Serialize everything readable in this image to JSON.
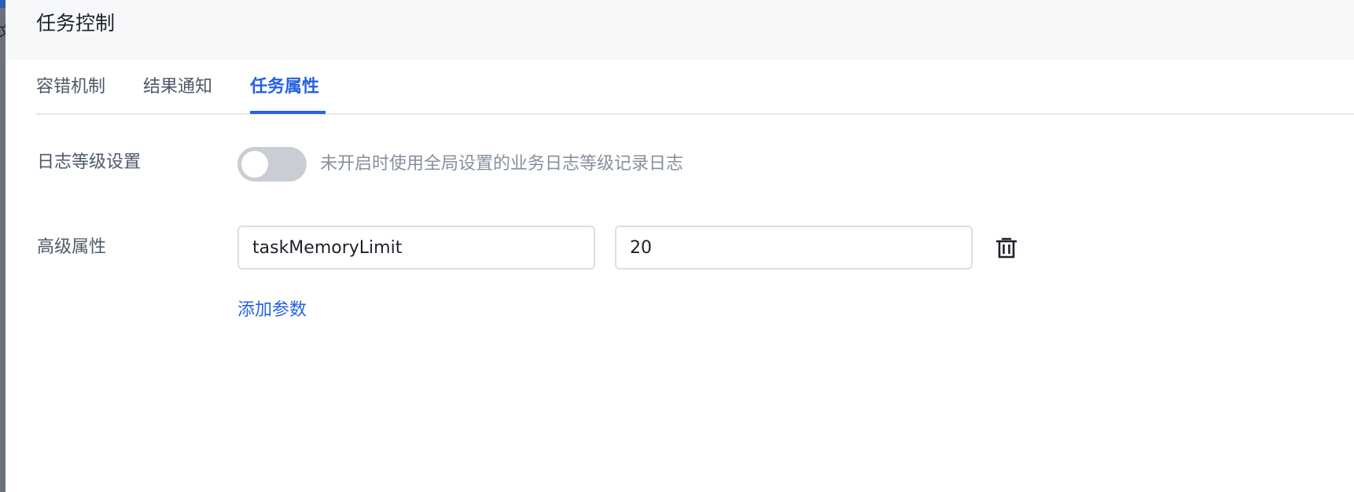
{
  "backdrop": {
    "partial_glyph": "文"
  },
  "panel": {
    "title": "任务控制"
  },
  "tabs": [
    {
      "label": "容错机制",
      "active": false
    },
    {
      "label": "结果通知",
      "active": false
    },
    {
      "label": "任务属性",
      "active": true
    }
  ],
  "log_level": {
    "label": "日志等级设置",
    "enabled": false,
    "hint": "未开启时使用全局设置的业务日志等级记录日志"
  },
  "advanced": {
    "label": "高级属性",
    "params": [
      {
        "key": "taskMemoryLimit",
        "value": "20"
      }
    ],
    "delete_icon": "trash-icon",
    "add_label": "添加参数"
  },
  "colors": {
    "accent": "#2662e0",
    "header_bg": "#f7f8fa",
    "toggle_off": "#c9cdd4",
    "hint_text": "#86909c",
    "label_text": "#4e5969"
  }
}
